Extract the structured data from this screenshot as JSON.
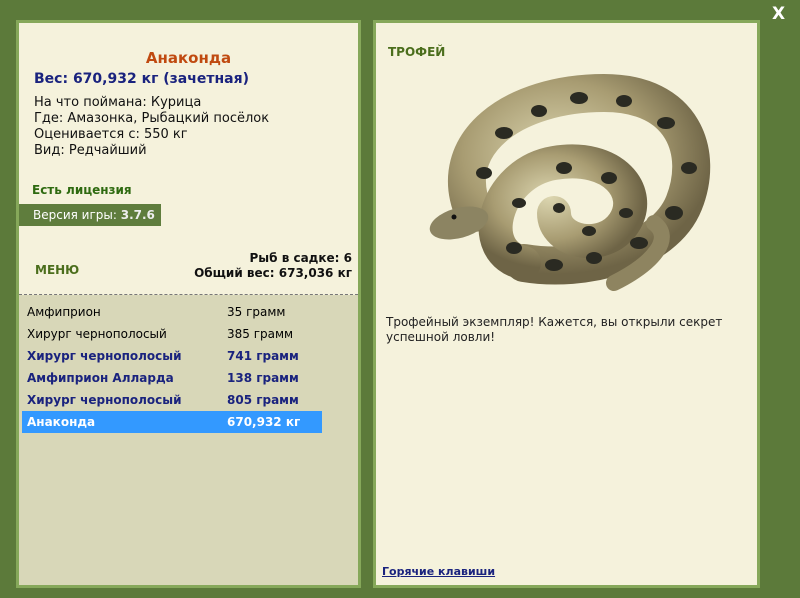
{
  "fish": {
    "name": "Анаконда",
    "weight": "Вес: 670,932 кг (зачетная)",
    "caught_on": "На что поймана: Курица",
    "where": "Где: Амазонка, Рыбацкий посёлок",
    "valued_from": "Оценивается с: 550 кг",
    "kind": "Вид: Редчайший"
  },
  "license": "Есть лицензия",
  "version": {
    "label": "Версия игры:",
    "value": "3.7.6"
  },
  "menu": "МЕНЮ",
  "stats": {
    "in_keepnet": "Рыб в садке: 6",
    "total_weight": "Общий вес: 673,036 кг"
  },
  "catch_list": [
    {
      "name": "Амфиприон",
      "weight": "35 грамм"
    },
    {
      "name": "Хирург чернополосый",
      "weight": "385 грамм"
    },
    {
      "name": "Хирург чернополосый",
      "weight": "741 грамм"
    },
    {
      "name": "Амфиприон Алларда",
      "weight": "138 грамм"
    },
    {
      "name": "Хирург чернополосый",
      "weight": "805 грамм"
    },
    {
      "name": "Анаконда",
      "weight": "670,932 кг"
    }
  ],
  "trophy": {
    "label": "ТРОФЕЙ",
    "description": "Трофейный экземпляр! Кажется, вы открыли секрет успешной ловли!"
  },
  "hotkeys": "Горячие клавиши",
  "close": "X",
  "colors": {
    "background": "#5c7a3a",
    "panel": "#f5f2dc",
    "border": "#86a85a",
    "selected": "#3399ff"
  }
}
